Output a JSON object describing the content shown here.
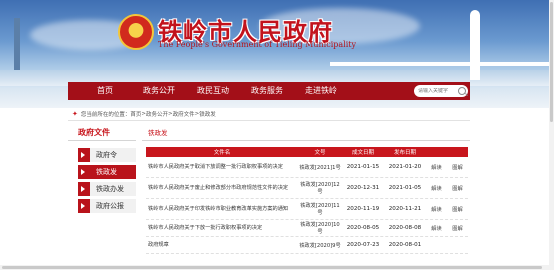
{
  "header": {
    "title": "铁岭市人民政府",
    "subtitle": "The People's Government of Tieling Municipality"
  },
  "nav": {
    "items": [
      "首页",
      "政务公开",
      "政民互动",
      "政务服务",
      "走进铁岭"
    ],
    "search_placeholder": "请输入关键字"
  },
  "breadcrumb": {
    "prefix": "您当前所在的位置：",
    "path": [
      "首页",
      "政务公开",
      "政府文件",
      "铁政发"
    ],
    "separator": " > "
  },
  "sidebar": {
    "title": "政府文件",
    "items": [
      {
        "label": "政府令",
        "active": false
      },
      {
        "label": "铁政发",
        "active": true
      },
      {
        "label": "铁政办发",
        "active": false
      },
      {
        "label": "政府公报",
        "active": false
      }
    ]
  },
  "main": {
    "title": "铁政发",
    "table": {
      "headers": [
        "文件名",
        "文号",
        "成文日期",
        "发布日期"
      ],
      "rows": [
        {
          "name": "铁岭市人民政府关于取消下放调整一批行政职权事项的决定",
          "number": "铁政发[2021]1号",
          "written": "2021-01-15",
          "published": "2021-01-20",
          "ops": [
            "解读",
            "图解"
          ]
        },
        {
          "name": "铁岭市人民政府关于废止和修改部分市政府规范性文件的决定",
          "number": "铁政发[2020]12号",
          "written": "2020-12-31",
          "published": "2021-01-05",
          "ops": [
            "解读",
            "图解"
          ]
        },
        {
          "name": "铁岭市人民政府关于印发铁岭市职业教育改革实施方案的通知",
          "number": "铁政发[2020]11号",
          "written": "2020-11-19",
          "published": "2020-11-21",
          "ops": [
            "解读",
            "图解"
          ]
        },
        {
          "name": "铁岭市人民政府关于下放一批行政职权事项的决定",
          "number": "铁政发[2020]10号",
          "written": "2020-08-05",
          "published": "2020-08-08",
          "ops": [
            "解读",
            "图解"
          ]
        },
        {
          "name": "政府规章",
          "number": "铁政发[2020]9号",
          "written": "2020-07-23",
          "published": "2020-08-01",
          "ops": []
        }
      ]
    }
  },
  "colors": {
    "brand_red": "#c8161d",
    "nav_red": "#a30f18"
  }
}
